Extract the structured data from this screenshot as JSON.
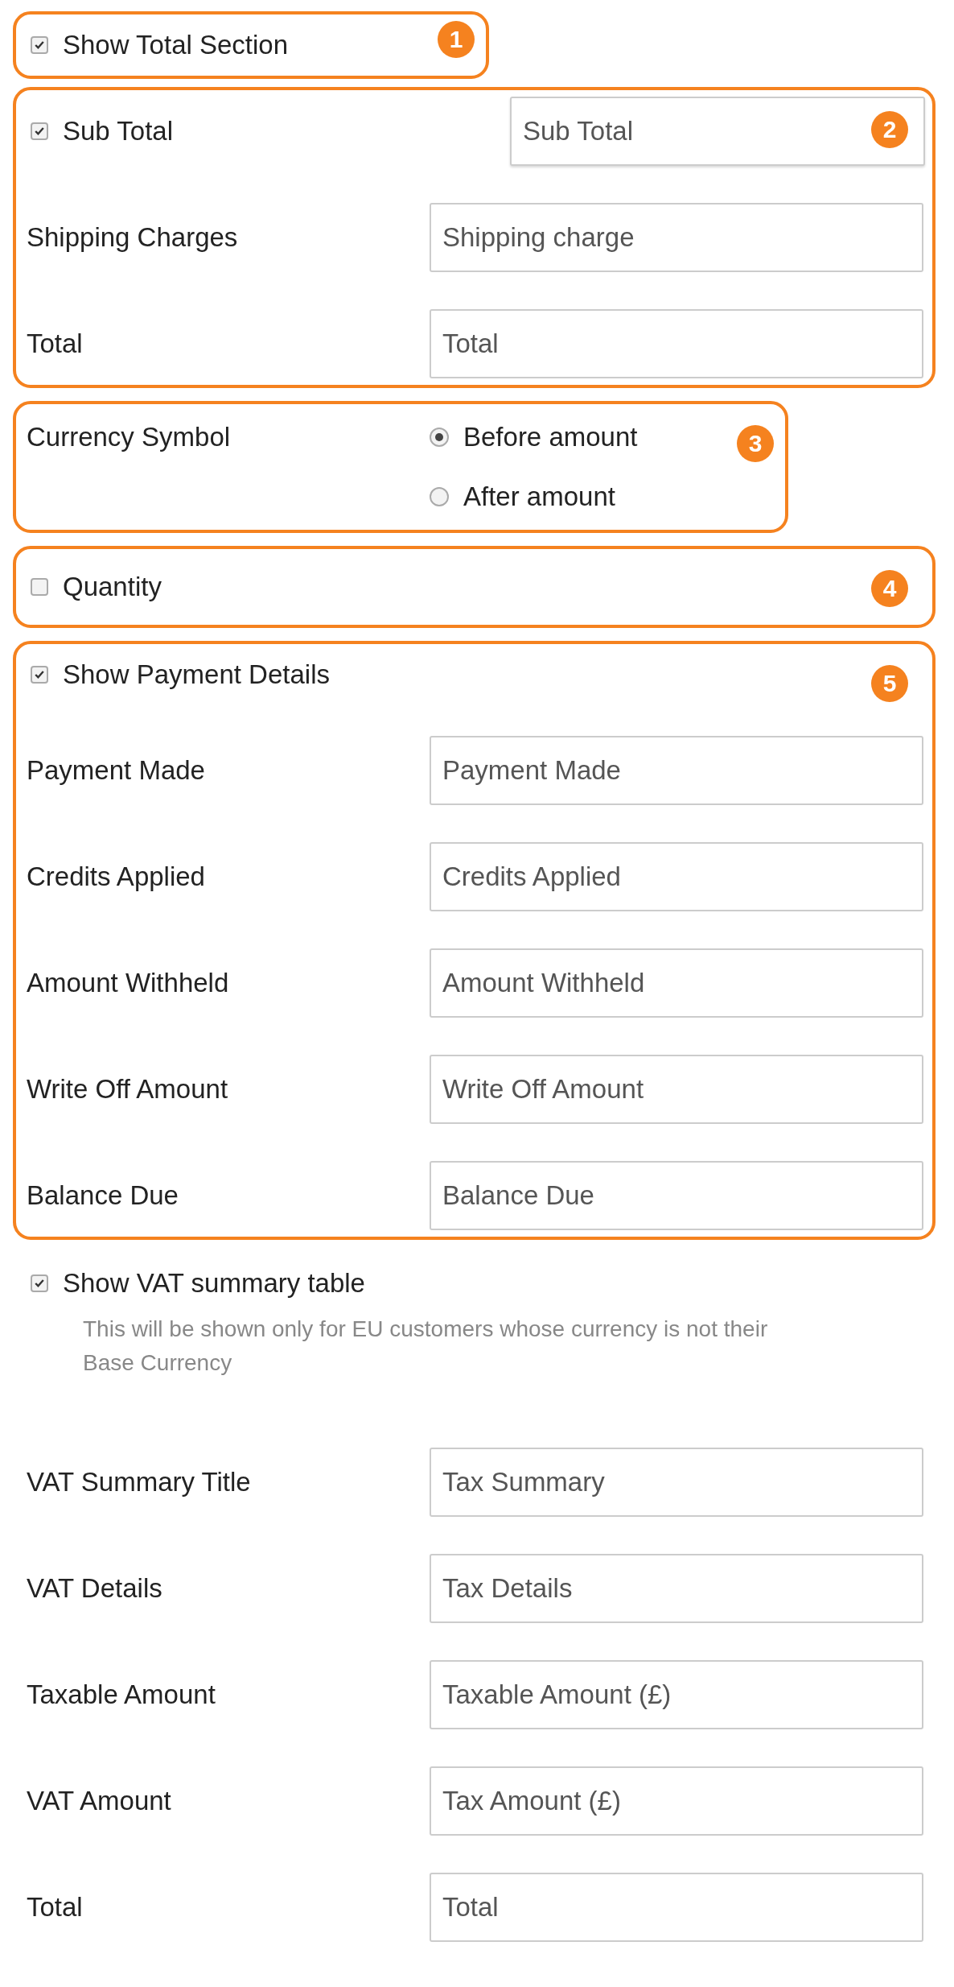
{
  "sections": [
    {
      "badge": "1",
      "rows": [
        {
          "kind": "checkbox",
          "label": "Show Total Section",
          "checked": true
        }
      ]
    },
    {
      "badge": "2",
      "rows": [
        {
          "kind": "checkbox",
          "label": "Sub Total",
          "checked": true,
          "placeholder": "Sub Total"
        },
        {
          "kind": "field",
          "label": "Shipping Charges",
          "placeholder": "Shipping charge"
        },
        {
          "kind": "field",
          "label": "Total",
          "placeholder": "Total"
        }
      ]
    },
    {
      "badge": "3",
      "rows": [
        {
          "kind": "radio",
          "label": "Currency Symbol",
          "options": [
            {
              "label": "Before amount",
              "selected": true
            },
            {
              "label": "After amount",
              "selected": false
            }
          ]
        }
      ]
    },
    {
      "badge": "4",
      "rows": [
        {
          "kind": "checkbox",
          "label": "Quantity",
          "checked": false
        }
      ]
    },
    {
      "badge": "5",
      "rows": [
        {
          "kind": "checkbox",
          "label": "Show Payment Details",
          "checked": true
        },
        {
          "kind": "field",
          "label": "Payment Made",
          "placeholder": "Payment Made"
        },
        {
          "kind": "field",
          "label": "Credits Applied",
          "placeholder": "Credits Applied"
        },
        {
          "kind": "field",
          "label": "Amount Withheld",
          "placeholder": "Amount Withheld"
        },
        {
          "kind": "field",
          "label": "Write Off Amount",
          "placeholder": "Write Off Amount"
        },
        {
          "kind": "field",
          "label": "Balance Due",
          "placeholder": "Balance Due"
        }
      ]
    }
  ],
  "vat": {
    "label": "Show VAT summary table",
    "checked": true,
    "help": "This will be shown only for EU customers whose currency is not their Base Currency",
    "fields": [
      {
        "label": "VAT Summary Title",
        "placeholder": "Tax Summary"
      },
      {
        "label": "VAT Details",
        "placeholder": "Tax Details"
      },
      {
        "label": "Taxable Amount",
        "placeholder": "Taxable Amount (£)"
      },
      {
        "label": "VAT Amount",
        "placeholder": "Tax Amount (£)"
      },
      {
        "label": "Total",
        "placeholder": "Total"
      }
    ]
  }
}
